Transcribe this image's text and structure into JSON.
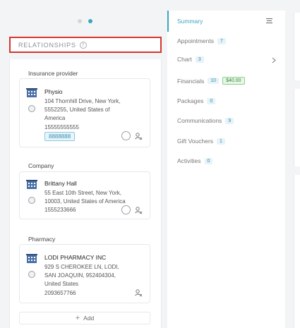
{
  "relationships": {
    "title": "RELATIONSHIPS",
    "help_icon": "help-circle-icon",
    "groups": [
      {
        "label": "Insurance provider",
        "name": "Physio",
        "address_lines": [
          "104 Thornhill Drive, New York,",
          "5552255, United States of",
          "America"
        ],
        "phone": "15555555555",
        "badge": "8888888"
      },
      {
        "label": "Company",
        "name": "Brittany Hall",
        "address_lines": [
          "55 East 10th Street, New York,",
          "10003, United States of America"
        ],
        "phone": "1555233666"
      },
      {
        "label": "Pharmacy",
        "name": "LODI PHARMACY INC",
        "address_lines": [
          "929 S CHEROKEE LN, LODI,",
          "SAN JOAQUIN, 952404304,",
          "United States"
        ],
        "phone": "2093657766"
      }
    ],
    "add_label": "Add"
  },
  "nav": {
    "items": [
      {
        "label": "Summary"
      },
      {
        "label": "Appointments",
        "count": "7"
      },
      {
        "label": "Chart",
        "count": "3"
      },
      {
        "label": "Financials",
        "count": "10",
        "amount": "$40.00"
      },
      {
        "label": "Packages",
        "count": "0"
      },
      {
        "label": "Communications",
        "count": "9"
      },
      {
        "label": "Gift Vouchers",
        "count": "1"
      },
      {
        "label": "Activities",
        "count": "0"
      }
    ]
  },
  "colors": {
    "accent": "#3aa7c0",
    "highlight_border": "#d6352f",
    "money": "#2f8a3a"
  }
}
